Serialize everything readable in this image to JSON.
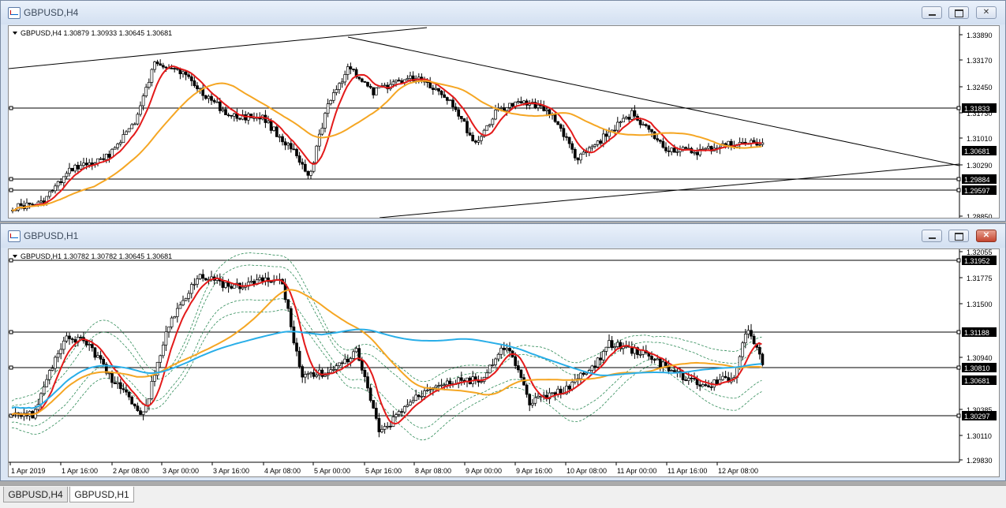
{
  "windows": {
    "h4": {
      "title": "GBPUSD,H4",
      "info": "GBPUSD,H4  1.30879 1.30933 1.30645 1.30681",
      "price_axis": [
        "1.33890",
        "1.33170",
        "1.32450",
        "1.31730",
        "1.31010",
        "1.30290",
        "1.28850"
      ],
      "tags": [
        "1.31833",
        "1.30681",
        "1.29884",
        "1.29597"
      ]
    },
    "h1": {
      "title": "GBPUSD,H1",
      "info": "GBPUSD,H1  1.30782 1.30782 1.30645 1.30681",
      "price_axis": [
        "1.32055",
        "1.31775",
        "1.31500",
        "1.30940",
        "1.30385",
        "1.30110",
        "1.29830"
      ],
      "tags": [
        "1.31952",
        "1.31188",
        "1.30810",
        "1.30681",
        "1.30297"
      ],
      "time_axis": [
        "1 Apr 2019",
        "1 Apr 16:00",
        "2 Apr 08:00",
        "3 Apr 00:00",
        "3 Apr 16:00",
        "4 Apr 08:00",
        "5 Apr 00:00",
        "5 Apr 16:00",
        "8 Apr 08:00",
        "9 Apr 00:00",
        "9 Apr 16:00",
        "10 Apr 08:00",
        "11 Apr 00:00",
        "11 Apr 16:00",
        "12 Apr 08:00"
      ]
    }
  },
  "tabs": [
    "GBPUSD,H4",
    "GBPUSD,H1"
  ],
  "active_tab": "GBPUSD,H1",
  "colors": {
    "fast_ma": "#e31a1a",
    "slow_ma": "#f5a623",
    "long_ma": "#29aee8",
    "bands": "#2e8b57",
    "tag_bg": "#000000"
  }
}
